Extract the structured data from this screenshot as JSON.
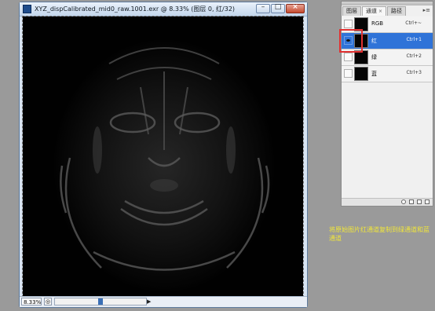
{
  "document": {
    "title": "XYZ_dispCalibrated_mid0_raw.1001.exr @ 8.33% (图层 0, 红/32)",
    "zoom": "8.33%",
    "window_buttons": [
      "minimize",
      "maximize",
      "close"
    ],
    "scroll_position": 0.5
  },
  "panel": {
    "tabs": [
      {
        "label": "图层"
      },
      {
        "label": "通道",
        "close": "×",
        "active": true
      },
      {
        "label": "路径"
      }
    ],
    "menu_glyph": "▸≡",
    "channels": [
      {
        "name": "RGB",
        "shortcut": "Ctrl+~",
        "selected": false,
        "visible": false
      },
      {
        "name": "红",
        "shortcut": "Ctrl+1",
        "selected": true,
        "visible": true
      },
      {
        "name": "绿",
        "shortcut": "Ctrl+2",
        "selected": false,
        "visible": false
      },
      {
        "name": "蓝",
        "shortcut": "Ctrl+3",
        "selected": false,
        "visible": false
      }
    ],
    "footer_icons": [
      "load-selection-icon",
      "save-selection-icon",
      "new-channel-icon",
      "delete-channel-icon"
    ]
  },
  "annotation": "将原始图片红通道复制到绿通道和蓝通道",
  "colors": {
    "selection": "#2f73d8",
    "highlight_box": "#e23131",
    "annotation": "#f0e53a"
  }
}
